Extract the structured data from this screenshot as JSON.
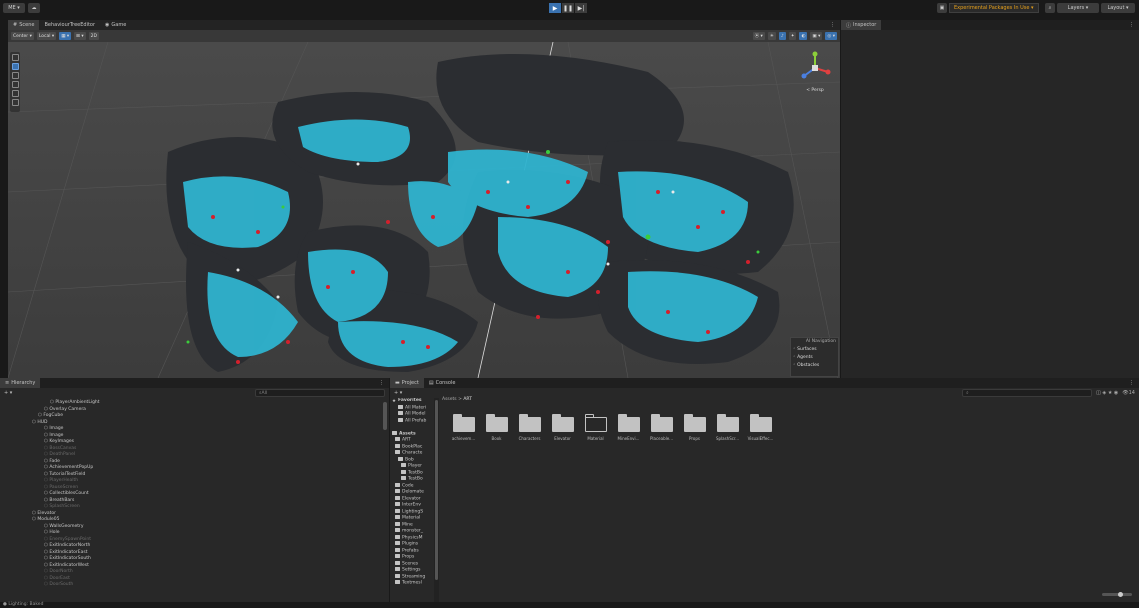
{
  "topbar": {
    "account_label": "ME ▾",
    "cloud_label": "☁",
    "experimental_label": "Experimental Packages In Use ▾",
    "layers_label": "Layers",
    "layout_label": "Layout"
  },
  "scene_tabs": [
    {
      "label": "Scene",
      "active": true
    },
    {
      "label": "BehaviourTreeEditor",
      "active": false
    },
    {
      "label": "Game",
      "active": false
    }
  ],
  "scene_toolbar": {
    "pivot_label": "Center ▾",
    "space_label": "Local ▾",
    "view_2d_label": "2D",
    "draw_mode_label": "⦿ ▾"
  },
  "gizmo": {
    "projection_label": "< Persp"
  },
  "ai_navigation": {
    "title": "AI Navigation",
    "items": [
      "Surfaces",
      "Agents",
      "Obstacles"
    ]
  },
  "inspector": {
    "tab_label": "Inspector"
  },
  "hierarchy": {
    "tab_label": "Hierarchy",
    "search_placeholder": "All",
    "rows": [
      {
        "label": "PlayerAmbientLight",
        "indent": 7,
        "dim": false
      },
      {
        "label": "Overlay Camera",
        "indent": 6,
        "dim": false
      },
      {
        "label": "FogCube",
        "indent": 5,
        "dim": false
      },
      {
        "label": "HUD",
        "indent": 4,
        "dim": false
      },
      {
        "label": "Image",
        "indent": 6,
        "dim": false
      },
      {
        "label": "Image",
        "indent": 6,
        "dim": false
      },
      {
        "label": "KeyImages",
        "indent": 6,
        "dim": false
      },
      {
        "label": "BossCanvas",
        "indent": 6,
        "dim": true
      },
      {
        "label": "DeathPanel",
        "indent": 6,
        "dim": true
      },
      {
        "label": "Fade",
        "indent": 6,
        "dim": false
      },
      {
        "label": "AchievementPopUp",
        "indent": 6,
        "dim": false
      },
      {
        "label": "TutorialTextField",
        "indent": 6,
        "dim": false
      },
      {
        "label": "PlayerHealth",
        "indent": 6,
        "dim": true
      },
      {
        "label": "PauseScreen",
        "indent": 6,
        "dim": true
      },
      {
        "label": "CollectiblesCount",
        "indent": 6,
        "dim": false
      },
      {
        "label": "BreathBars",
        "indent": 6,
        "dim": false
      },
      {
        "label": "SplashScreen",
        "indent": 6,
        "dim": true
      },
      {
        "label": "Elevator",
        "indent": 4,
        "dim": false
      },
      {
        "label": "Module05",
        "indent": 4,
        "dim": false
      },
      {
        "label": "WallsGeometry",
        "indent": 6,
        "dim": false
      },
      {
        "label": "Hole",
        "indent": 6,
        "dim": false
      },
      {
        "label": "EnemySpawnPoint",
        "indent": 6,
        "dim": true
      },
      {
        "label": "ExitIndicatorNorth",
        "indent": 6,
        "dim": false
      },
      {
        "label": "ExitIndicatorEast",
        "indent": 6,
        "dim": false
      },
      {
        "label": "ExitIndicatorSouth",
        "indent": 6,
        "dim": false
      },
      {
        "label": "ExitIndicatorWest",
        "indent": 6,
        "dim": false
      },
      {
        "label": "DoorNorth",
        "indent": 6,
        "dim": true
      },
      {
        "label": "DoorEast",
        "indent": 6,
        "dim": true
      },
      {
        "label": "DoorSouth",
        "indent": 6,
        "dim": true
      }
    ]
  },
  "project": {
    "tabs": [
      {
        "label": "Project",
        "active": true
      },
      {
        "label": "Console",
        "active": false
      }
    ],
    "breadcrumb_root": "Assets",
    "breadcrumb_sep": ">",
    "breadcrumb_current": "ART",
    "item_count": "14",
    "tree": [
      {
        "label": "Favorites",
        "indent": 0,
        "bold": true
      },
      {
        "label": "All Materi",
        "indent": 2,
        "bold": false
      },
      {
        "label": "All Model",
        "indent": 2,
        "bold": false
      },
      {
        "label": "All Prefab",
        "indent": 2,
        "bold": false
      },
      {
        "label": "",
        "indent": 0,
        "bold": false
      },
      {
        "label": "Assets",
        "indent": 0,
        "bold": true
      },
      {
        "label": "ART",
        "indent": 1,
        "bold": false
      },
      {
        "label": "BookPlac",
        "indent": 1,
        "bold": false
      },
      {
        "label": "Characte",
        "indent": 1,
        "bold": false
      },
      {
        "label": "Bob",
        "indent": 2,
        "bold": false
      },
      {
        "label": "Player",
        "indent": 3,
        "bold": false
      },
      {
        "label": "TestBo",
        "indent": 3,
        "bold": false
      },
      {
        "label": "TestBo",
        "indent": 3,
        "bold": false
      },
      {
        "label": "Code",
        "indent": 1,
        "bold": false
      },
      {
        "label": "Delomate",
        "indent": 1,
        "bold": false
      },
      {
        "label": "Elevator",
        "indent": 1,
        "bold": false
      },
      {
        "label": "InterEnv",
        "indent": 1,
        "bold": false
      },
      {
        "label": "LightingS",
        "indent": 1,
        "bold": false
      },
      {
        "label": "Material",
        "indent": 1,
        "bold": false
      },
      {
        "label": "Mine",
        "indent": 1,
        "bold": false
      },
      {
        "label": "monster_",
        "indent": 1,
        "bold": false
      },
      {
        "label": "PhysicsM",
        "indent": 1,
        "bold": false
      },
      {
        "label": "Plugins",
        "indent": 1,
        "bold": false
      },
      {
        "label": "Prefabs",
        "indent": 1,
        "bold": false
      },
      {
        "label": "Props",
        "indent": 1,
        "bold": false
      },
      {
        "label": "Scenes",
        "indent": 1,
        "bold": false
      },
      {
        "label": "Settings",
        "indent": 1,
        "bold": false
      },
      {
        "label": "Streaming",
        "indent": 1,
        "bold": false
      },
      {
        "label": "Textmesl",
        "indent": 1,
        "bold": false
      }
    ],
    "folders": [
      {
        "label": "achievem...",
        "outline": false
      },
      {
        "label": "Book",
        "outline": false
      },
      {
        "label": "Characters",
        "outline": false
      },
      {
        "label": "Elevator",
        "outline": false
      },
      {
        "label": "Material",
        "outline": true
      },
      {
        "label": "MineEnvi...",
        "outline": false
      },
      {
        "label": "Placeable...",
        "outline": false
      },
      {
        "label": "Props",
        "outline": false
      },
      {
        "label": "SplashScr...",
        "outline": false
      },
      {
        "label": "VisualEffec...",
        "outline": false
      }
    ]
  },
  "status": {
    "text": "Lighting: Baked"
  },
  "colors": {
    "accent": "#3a72b0",
    "navmesh": "#2fb3cf",
    "warning": "#e6a01b"
  }
}
